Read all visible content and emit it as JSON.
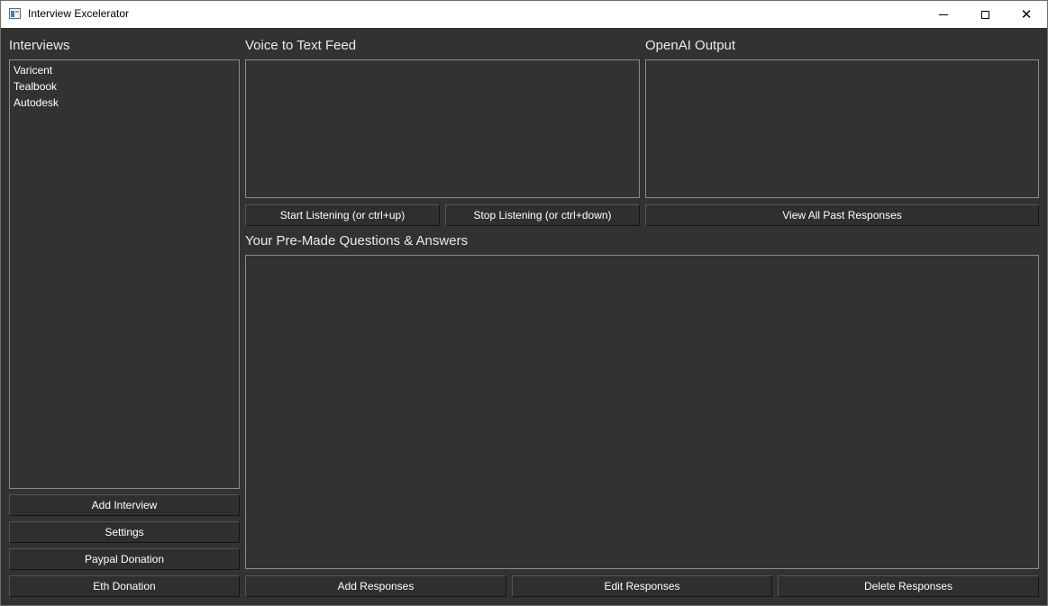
{
  "window": {
    "title": "Interview Excelerator",
    "controls": [
      "minimize-icon",
      "maximize-icon",
      "close-icon"
    ]
  },
  "interviews": {
    "label": "Interviews",
    "items": [
      "Varicent",
      "Tealbook",
      "Autodesk"
    ],
    "buttons": {
      "add": "Add Interview",
      "settings": "Settings",
      "paypal": "Paypal Donation",
      "eth": "Eth Donation"
    }
  },
  "voice": {
    "label": "Voice to Text Feed",
    "start_label": "Start Listening (or ctrl+up)",
    "stop_label": "Stop Listening (or ctrl+down)"
  },
  "openai": {
    "label": "OpenAI Output",
    "view_past_label": "View All Past Responses"
  },
  "premade": {
    "label": "Your Pre-Made Questions & Answers",
    "add_label": "Add Responses",
    "edit_label": "Edit Responses",
    "delete_label": "Delete Responses"
  },
  "colors": {
    "background": "#323232",
    "border": "#8a8a8a",
    "text": "#ffffff",
    "titlebar": "#ffffff"
  }
}
